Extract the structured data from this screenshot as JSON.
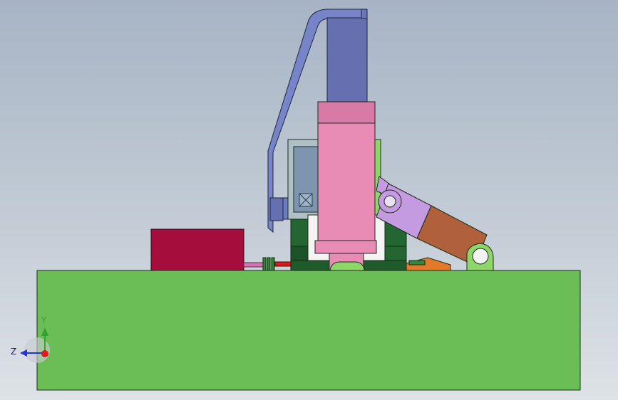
{
  "viewport": {
    "colors": {
      "base": "#6bbd55",
      "outline": "#1e2a1a",
      "red_block": "#a50d3c",
      "pink": "#e88cb6",
      "pink_dark": "#d77ba6",
      "blue_cylinder": "#6670b0",
      "blue_bracket": "#7884c8",
      "dark_green": "#1f5a2a",
      "light_green": "#8fd66a",
      "lavender": "#c49ae0",
      "brown": "#b0603a",
      "orange": "#e27a2a"
    }
  },
  "triad": {
    "z_label": "Z",
    "y_label": "Y",
    "colors": {
      "x": "#e01b1b",
      "y": "#2fa52f",
      "z": "#2035d6"
    }
  }
}
